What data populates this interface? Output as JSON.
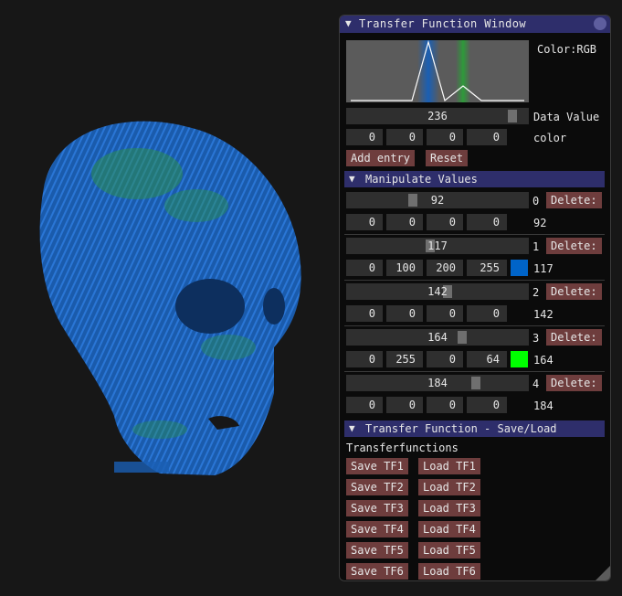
{
  "window": {
    "title": "Transfer Function Window",
    "color_mode_label": "Color:RGB",
    "data_value": "236",
    "data_value_label": "Data Value",
    "color_fields": [
      "0",
      "0",
      "0",
      "0"
    ],
    "color_label": "color",
    "add_entry_label": "Add entry",
    "reset_label": "Reset",
    "data_value_fraction": 0.93
  },
  "manipulate": {
    "header": "Manipulate Values",
    "delete_label": "Delete:",
    "entries": [
      {
        "value": "92",
        "index": "0",
        "rgba": [
          "0",
          "0",
          "0",
          "0"
        ],
        "value_out": "92",
        "swatch": null,
        "fraction": 0.36
      },
      {
        "value": "117",
        "index": "1",
        "rgba": [
          "0",
          "100",
          "200",
          "255"
        ],
        "value_out": "117",
        "swatch": "#0064c8",
        "fraction": 0.46
      },
      {
        "value": "142",
        "index": "2",
        "rgba": [
          "0",
          "0",
          "0",
          "0"
        ],
        "value_out": "142",
        "swatch": null,
        "fraction": 0.56
      },
      {
        "value": "164",
        "index": "3",
        "rgba": [
          "0",
          "255",
          "0",
          "64"
        ],
        "value_out": "164",
        "swatch": "#00ff00",
        "fraction": 0.64
      },
      {
        "value": "184",
        "index": "4",
        "rgba": [
          "0",
          "0",
          "0",
          "0"
        ],
        "value_out": "184",
        "swatch": null,
        "fraction": 0.72
      }
    ]
  },
  "saveload": {
    "header": "Transfer Function - Save/Load",
    "subtitle": "Transferfunctions",
    "buttons": [
      {
        "save": "Save TF1",
        "load": "Load TF1"
      },
      {
        "save": "Save TF2",
        "load": "Load TF2"
      },
      {
        "save": "Save TF3",
        "load": "Load TF3"
      },
      {
        "save": "Save TF4",
        "load": "Load TF4"
      },
      {
        "save": "Save TF5",
        "load": "Load TF5"
      },
      {
        "save": "Save TF6",
        "load": "Load TF6"
      }
    ]
  },
  "colors": {
    "header_bg": "#2e2e6b",
    "button_bg": "#6e3d3d",
    "histogram_bg": "#5b5b5b",
    "skull_blue": "#1a5fb4",
    "skull_green": "#2e9a3a"
  },
  "icons": {
    "collapse": "triangle-down-icon",
    "close": "circle-close-icon",
    "resize": "resize-grip-icon"
  }
}
